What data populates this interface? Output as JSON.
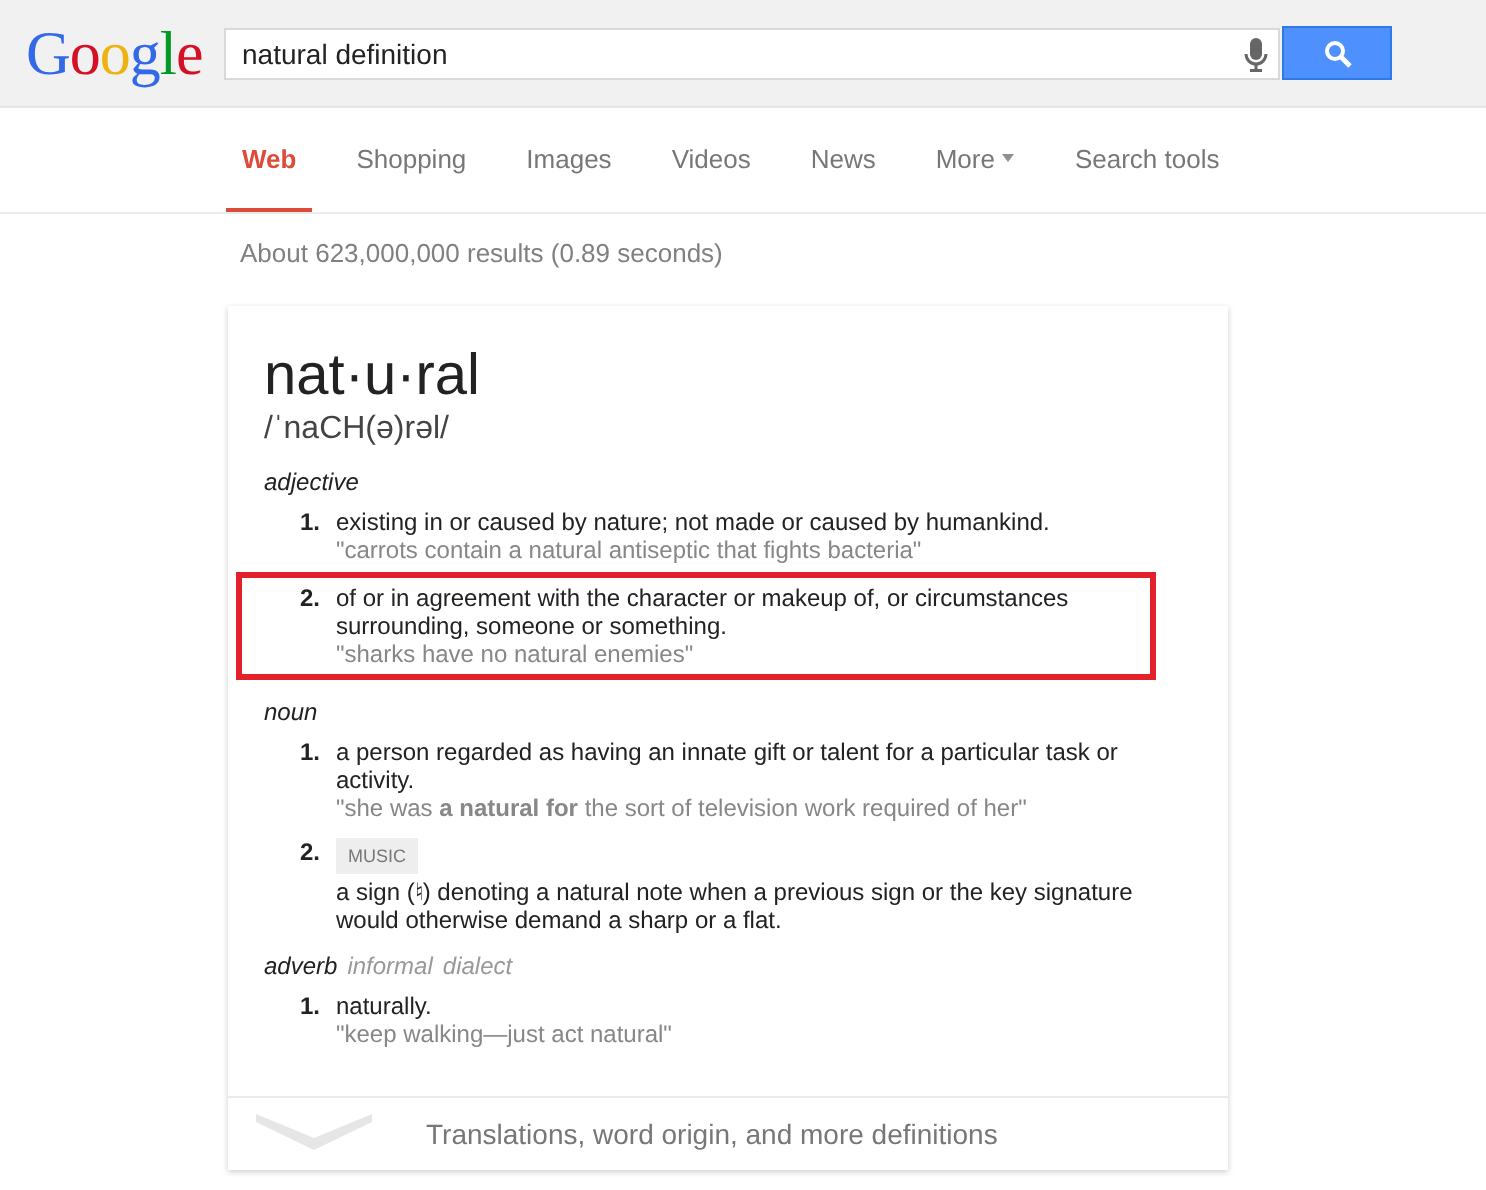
{
  "logo": "Google",
  "search": {
    "value": "natural definition"
  },
  "tabs": [
    {
      "label": "Web",
      "selected": true,
      "dropdown": false
    },
    {
      "label": "Shopping",
      "selected": false,
      "dropdown": false
    },
    {
      "label": "Images",
      "selected": false,
      "dropdown": false
    },
    {
      "label": "Videos",
      "selected": false,
      "dropdown": false
    },
    {
      "label": "News",
      "selected": false,
      "dropdown": false
    },
    {
      "label": "More",
      "selected": false,
      "dropdown": true
    },
    {
      "label": "Search tools",
      "selected": false,
      "dropdown": false
    }
  ],
  "result_stats": "About 623,000,000 results (0.89 seconds)",
  "card": {
    "word": "nat·u·ral",
    "pronunciation": "/ˈnaCH(ə)rəl/",
    "senses": [
      {
        "pos": "adjective",
        "definitions": [
          {
            "number": "1.",
            "text": "existing in or caused by nature; not made or caused by humankind.",
            "example": "\"carrots contain a natural antiseptic that fights bacteria\"",
            "highlighted": false
          },
          {
            "number": "2.",
            "text": "of or in agreement with the character or makeup of, or circumstances surrounding, someone or something.",
            "example": "\"sharks have no natural enemies\"",
            "highlighted": true
          }
        ]
      },
      {
        "pos": "noun",
        "definitions": [
          {
            "number": "1.",
            "text": "a person regarded as having an innate gift or talent for a particular task or activity.",
            "example": "\"she was **a natural for** the sort of television work required of her\"",
            "highlighted": false
          },
          {
            "number": "2.",
            "tag": "MUSIC",
            "text": "a sign (♮) denoting a natural note when a previous sign or the key signature would otherwise demand a sharp or a flat.",
            "highlighted": false
          }
        ]
      },
      {
        "pos": "adverb",
        "labels": [
          "informal",
          "dialect"
        ],
        "definitions": [
          {
            "number": "1.",
            "text": "naturally.",
            "example": "\"keep walking—just act natural\"",
            "highlighted": false
          }
        ]
      }
    ],
    "more_link": "Translations, word origin, and more definitions"
  }
}
